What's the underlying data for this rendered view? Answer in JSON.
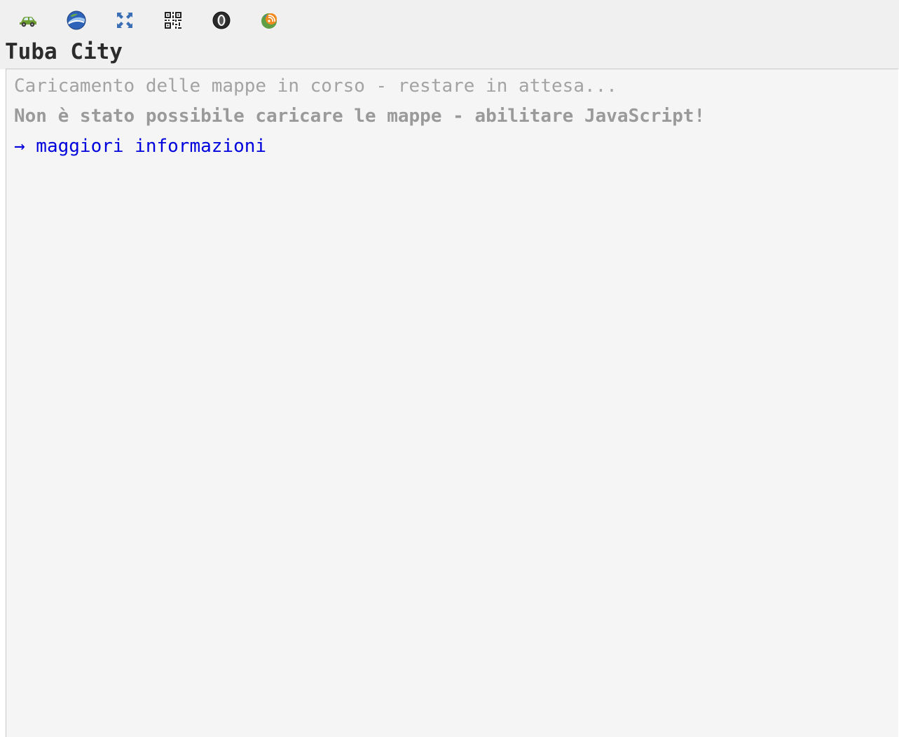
{
  "toolbar": {
    "icons": [
      {
        "name": "car-icon",
        "color": "#5a8f2a"
      },
      {
        "name": "google-earth-icon",
        "color": "#2a5fb0"
      },
      {
        "name": "fullscreen-icon",
        "color": "#3a6fb5"
      },
      {
        "name": "qr-code-icon",
        "color": "#222222"
      },
      {
        "name": "opera-icon",
        "color": "#333333"
      },
      {
        "name": "rss-feed-icon",
        "color": "#e8801a"
      }
    ]
  },
  "page": {
    "title": "Tuba City"
  },
  "map": {
    "loading_text": "Caricamento delle mappe in corso - restare in attesa...",
    "error_text": "Non è stato possibile caricare le mappe - abilitare JavaScript!",
    "more_info_link": "→ maggiori informazioni"
  }
}
